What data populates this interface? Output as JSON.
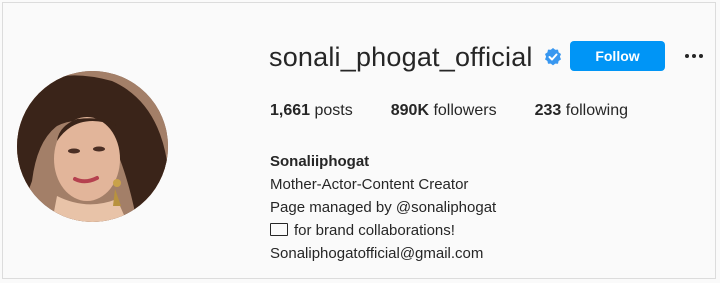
{
  "profile": {
    "username": "sonali_phogat_official",
    "verified": true,
    "follow_label": "Follow",
    "more_icon": "ellipsis-icon",
    "avatar_icon": "profile-photo"
  },
  "stats": {
    "posts_count": "1,661",
    "posts_label": "posts",
    "followers_count": "890K",
    "followers_label": "followers",
    "following_count": "233",
    "following_label": "following"
  },
  "bio": {
    "name": "Sonaliiphogat",
    "line1": "Mother-Actor-Content Creator",
    "line2": "Page managed by @sonaliphogat",
    "line3": "for brand collaborations!",
    "email": "Sonaliphogatofficial@gmail.com"
  },
  "colors": {
    "accent": "#0095f6",
    "text": "#262626",
    "background": "#fafafa"
  }
}
